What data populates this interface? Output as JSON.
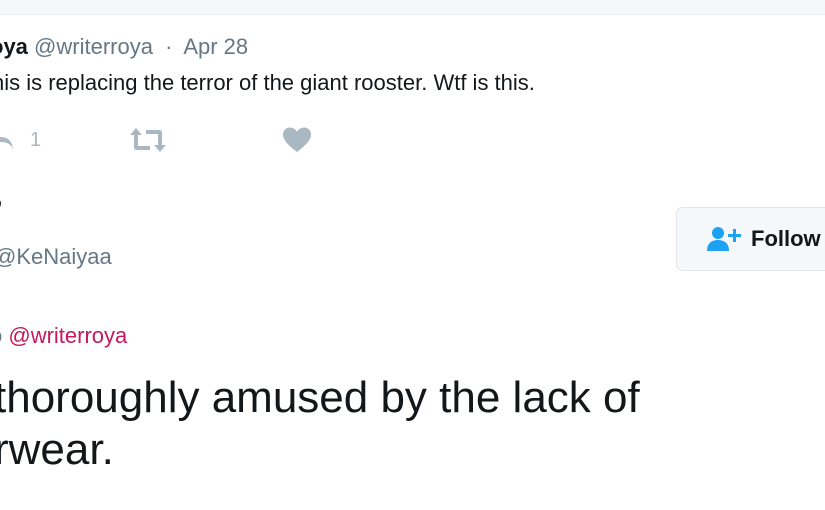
{
  "parent_tweet": {
    "name": "oya",
    "handle": "@writerroya",
    "separator": "·",
    "time": "Apr 28",
    "text": "his is replacing the terror of the giant rooster. Wtf is this.",
    "actions": {
      "reply_icon": "reply-icon",
      "reply_count": "1",
      "retweet_icon": "retweet-icon",
      "like_icon": "heart-icon"
    }
  },
  "reply_tweet": {
    "name_fragment": ",",
    "handle": "@KeNaiyaa",
    "follow_button": {
      "icon": "add-user-icon",
      "label": "Follow"
    },
    "replying_prefix": "o",
    "replying_mention": "@writerroya",
    "text": "thoroughly amused by the lack of\nrwear."
  },
  "colors": {
    "primary_text": "#14171a",
    "secondary_text": "#657786",
    "action_icon": "#aab8c2",
    "mention": "#c4185f",
    "follow_icon": "#1da1f2"
  }
}
